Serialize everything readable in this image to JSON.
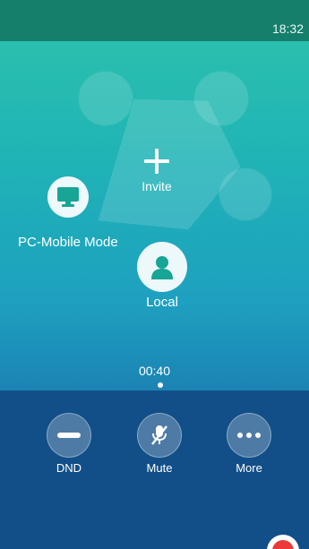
{
  "status_bar": {
    "time": "18:32"
  },
  "conference": {
    "invite_label": "Invite",
    "pc_mobile_label": "PC-Mobile Mode",
    "local_label": "Local",
    "timer": "00:40"
  },
  "actions": {
    "dnd": "DND",
    "mute": "Mute",
    "more": "More"
  },
  "icons": {
    "invite": "plus-icon",
    "pc_mobile": "monitor-icon",
    "local": "person-icon",
    "dnd": "minus-icon",
    "mute": "mic-muted-icon",
    "more": "more-dots-icon",
    "record": "record-icon"
  },
  "colors": {
    "status_bar": "#157f6c",
    "bottom_bar": "#124f88",
    "bubble_icon": "#17a596",
    "record": "#ec3a3a"
  }
}
